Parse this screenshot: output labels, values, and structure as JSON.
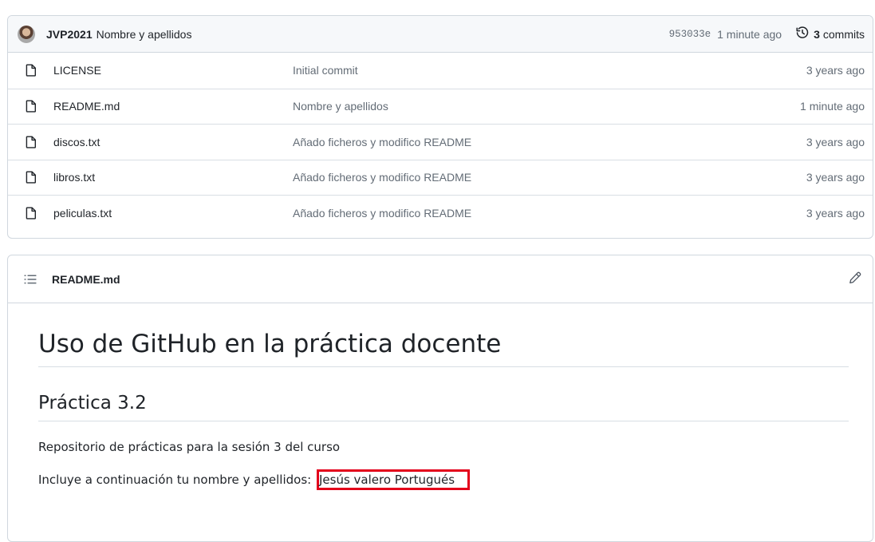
{
  "latest_commit": {
    "author": "JVP2021",
    "message": "Nombre y apellidos",
    "sha": "953033e",
    "time": "1 minute ago",
    "commits_count": "3",
    "commits_label": "commits"
  },
  "files": [
    {
      "name": "LICENSE",
      "commit": "Initial commit",
      "age": "3 years ago"
    },
    {
      "name": "README.md",
      "commit": "Nombre y apellidos",
      "age": "1 minute ago"
    },
    {
      "name": "discos.txt",
      "commit": "Añado ficheros y modifico README",
      "age": "3 years ago"
    },
    {
      "name": "libros.txt",
      "commit": "Añado ficheros y modifico README",
      "age": "3 years ago"
    },
    {
      "name": "peliculas.txt",
      "commit": "Añado ficheros y modifico README",
      "age": "3 years ago"
    }
  ],
  "readme": {
    "filename": "README.md",
    "h1": "Uso de GitHub en la práctica docente",
    "h2": "Práctica 3.2",
    "p1": "Repositorio de prácticas para la sesión 3 del curso",
    "p2_prefix": "Incluye a continuación tu nombre y apellidos:",
    "p2_name": "Jesús valero Portugués"
  },
  "icons": {
    "file": "file-icon",
    "list": "list-unordered-icon",
    "edit": "pencil-icon",
    "history": "history-icon"
  },
  "colors": {
    "highlight_border": "#e3001b",
    "muted_text": "#636c76"
  }
}
